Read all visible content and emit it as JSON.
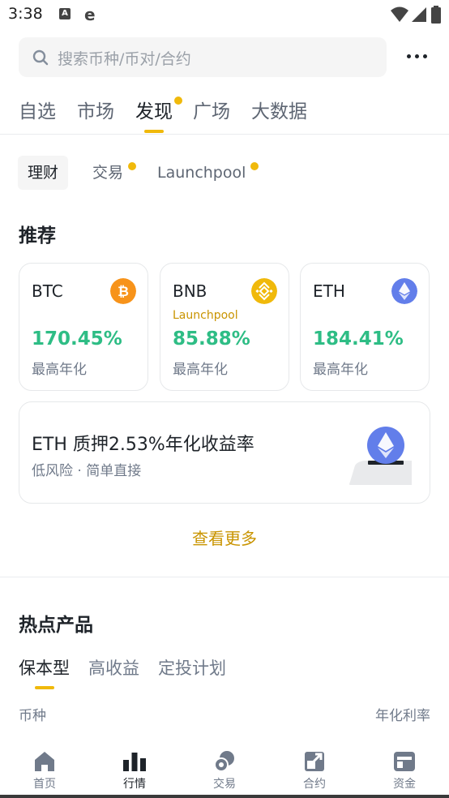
{
  "status_bar": {
    "time": "3:38",
    "notification_letter": "A",
    "browser_letter": "e"
  },
  "search": {
    "placeholder": "搜索币种/币对/合约"
  },
  "main_tabs": [
    {
      "label": "自选",
      "active": false,
      "dot": false
    },
    {
      "label": "市场",
      "active": false,
      "dot": false
    },
    {
      "label": "发现",
      "active": true,
      "dot": true
    },
    {
      "label": "广场",
      "active": false,
      "dot": false
    },
    {
      "label": "大数据",
      "active": false,
      "dot": false
    }
  ],
  "sub_tabs": [
    {
      "label": "理财",
      "active": true,
      "dot": false
    },
    {
      "label": "交易",
      "active": false,
      "dot": true
    },
    {
      "label": "Launchpool",
      "active": false,
      "dot": true
    }
  ],
  "recommend": {
    "title": "推荐",
    "cards": [
      {
        "coin": "BTC",
        "sub": "",
        "rate": "170.45%",
        "rate_label": "最高年化",
        "icon": "btc-icon",
        "icon_color": "#f7931a"
      },
      {
        "coin": "BNB",
        "sub": "Launchpool",
        "rate": "85.88%",
        "rate_label": "最高年化",
        "icon": "bnb-icon",
        "icon_color": "#f0b90b"
      },
      {
        "coin": "ETH",
        "sub": "",
        "rate": "184.41%",
        "rate_label": "最高年化",
        "icon": "eth-icon",
        "icon_color": "#627eea"
      }
    ]
  },
  "stake": {
    "title": "ETH 质押2.53%年化收益率",
    "subtitle": "低风险 · 简单直接",
    "icon": "eth-stake-illustration"
  },
  "see_more": "查看更多",
  "hot_products": {
    "title": "热点产品",
    "tabs": [
      {
        "label": "保本型",
        "active": true
      },
      {
        "label": "高收益",
        "active": false
      },
      {
        "label": "定投计划",
        "active": false
      }
    ],
    "column_left": "币种",
    "column_right": "年化利率"
  },
  "bottom_nav": [
    {
      "label": "首页",
      "icon": "home-icon",
      "active": false
    },
    {
      "label": "行情",
      "icon": "markets-icon",
      "active": true
    },
    {
      "label": "交易",
      "icon": "trade-icon",
      "active": false
    },
    {
      "label": "合约",
      "icon": "futures-icon",
      "active": false
    },
    {
      "label": "资金",
      "icon": "wallet-icon",
      "active": false
    }
  ],
  "colors": {
    "accent": "#f0b90b",
    "positive": "#2ebd85",
    "link": "#c99400"
  }
}
